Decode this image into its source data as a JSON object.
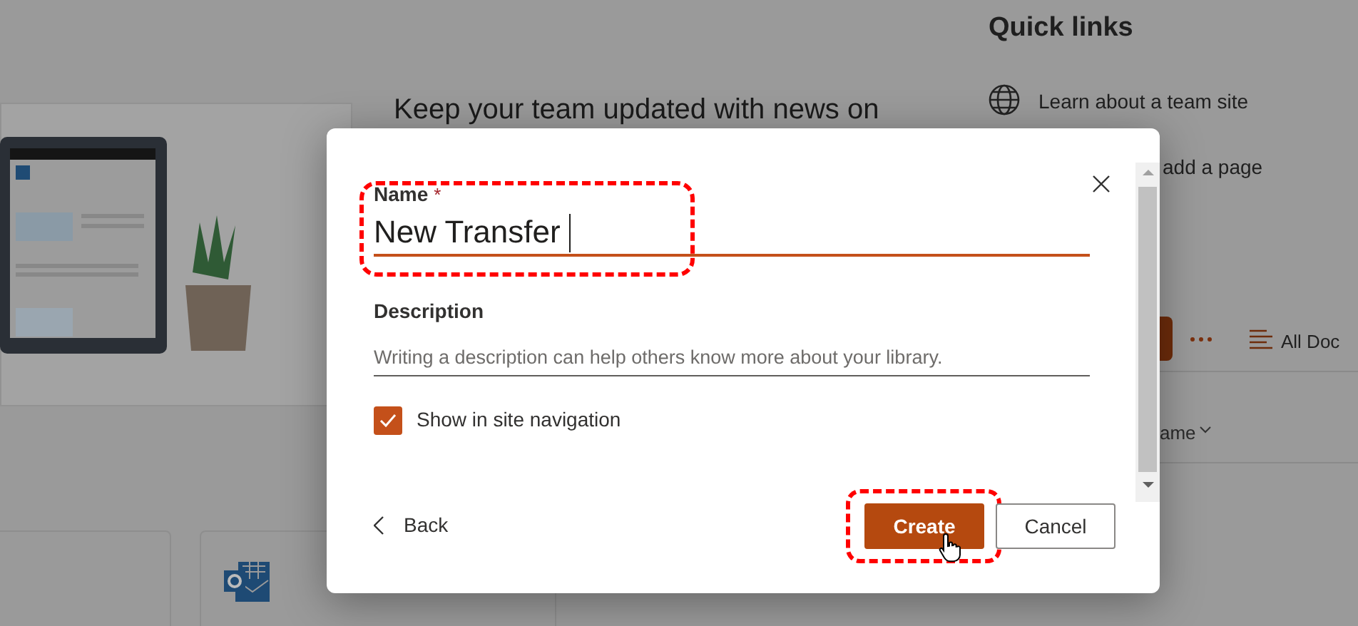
{
  "page": {
    "headline": "Keep your team updated with news on",
    "quick_links": {
      "title": "Quick links",
      "items": [
        {
          "label": "Learn about a team site"
        },
        {
          "label": "add a page"
        }
      ]
    },
    "toolbar": {
      "view": "All Doc"
    },
    "column_header": "ame"
  },
  "dialog": {
    "name_field": {
      "label": "Name",
      "required": "*",
      "value": "New Transfer",
      "highlighted": true
    },
    "description_field": {
      "label": "Description",
      "placeholder": "Writing a description can help others know more about your library."
    },
    "checkbox": {
      "label": "Show in site navigation",
      "checked": true
    },
    "back": "Back",
    "buttons": [
      {
        "label": "Create",
        "kind": "primary",
        "highlighted": true
      },
      {
        "label": "Cancel",
        "kind": "secondary",
        "highlighted": false
      }
    ]
  }
}
